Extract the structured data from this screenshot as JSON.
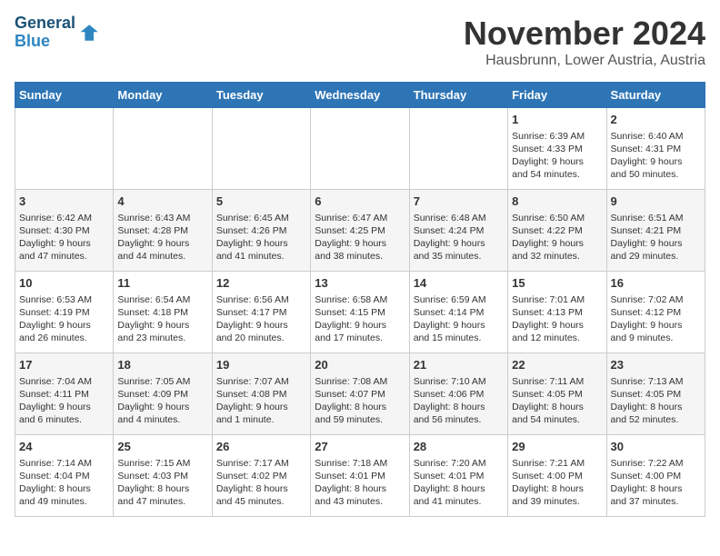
{
  "header": {
    "logo_line1": "General",
    "logo_line2": "Blue",
    "month": "November 2024",
    "location": "Hausbrunn, Lower Austria, Austria"
  },
  "weekdays": [
    "Sunday",
    "Monday",
    "Tuesday",
    "Wednesday",
    "Thursday",
    "Friday",
    "Saturday"
  ],
  "weeks": [
    [
      {
        "day": "",
        "info": ""
      },
      {
        "day": "",
        "info": ""
      },
      {
        "day": "",
        "info": ""
      },
      {
        "day": "",
        "info": ""
      },
      {
        "day": "",
        "info": ""
      },
      {
        "day": "1",
        "info": "Sunrise: 6:39 AM\nSunset: 4:33 PM\nDaylight: 9 hours\nand 54 minutes."
      },
      {
        "day": "2",
        "info": "Sunrise: 6:40 AM\nSunset: 4:31 PM\nDaylight: 9 hours\nand 50 minutes."
      }
    ],
    [
      {
        "day": "3",
        "info": "Sunrise: 6:42 AM\nSunset: 4:30 PM\nDaylight: 9 hours\nand 47 minutes."
      },
      {
        "day": "4",
        "info": "Sunrise: 6:43 AM\nSunset: 4:28 PM\nDaylight: 9 hours\nand 44 minutes."
      },
      {
        "day": "5",
        "info": "Sunrise: 6:45 AM\nSunset: 4:26 PM\nDaylight: 9 hours\nand 41 minutes."
      },
      {
        "day": "6",
        "info": "Sunrise: 6:47 AM\nSunset: 4:25 PM\nDaylight: 9 hours\nand 38 minutes."
      },
      {
        "day": "7",
        "info": "Sunrise: 6:48 AM\nSunset: 4:24 PM\nDaylight: 9 hours\nand 35 minutes."
      },
      {
        "day": "8",
        "info": "Sunrise: 6:50 AM\nSunset: 4:22 PM\nDaylight: 9 hours\nand 32 minutes."
      },
      {
        "day": "9",
        "info": "Sunrise: 6:51 AM\nSunset: 4:21 PM\nDaylight: 9 hours\nand 29 minutes."
      }
    ],
    [
      {
        "day": "10",
        "info": "Sunrise: 6:53 AM\nSunset: 4:19 PM\nDaylight: 9 hours\nand 26 minutes."
      },
      {
        "day": "11",
        "info": "Sunrise: 6:54 AM\nSunset: 4:18 PM\nDaylight: 9 hours\nand 23 minutes."
      },
      {
        "day": "12",
        "info": "Sunrise: 6:56 AM\nSunset: 4:17 PM\nDaylight: 9 hours\nand 20 minutes."
      },
      {
        "day": "13",
        "info": "Sunrise: 6:58 AM\nSunset: 4:15 PM\nDaylight: 9 hours\nand 17 minutes."
      },
      {
        "day": "14",
        "info": "Sunrise: 6:59 AM\nSunset: 4:14 PM\nDaylight: 9 hours\nand 15 minutes."
      },
      {
        "day": "15",
        "info": "Sunrise: 7:01 AM\nSunset: 4:13 PM\nDaylight: 9 hours\nand 12 minutes."
      },
      {
        "day": "16",
        "info": "Sunrise: 7:02 AM\nSunset: 4:12 PM\nDaylight: 9 hours\nand 9 minutes."
      }
    ],
    [
      {
        "day": "17",
        "info": "Sunrise: 7:04 AM\nSunset: 4:11 PM\nDaylight: 9 hours\nand 6 minutes."
      },
      {
        "day": "18",
        "info": "Sunrise: 7:05 AM\nSunset: 4:09 PM\nDaylight: 9 hours\nand 4 minutes."
      },
      {
        "day": "19",
        "info": "Sunrise: 7:07 AM\nSunset: 4:08 PM\nDaylight: 9 hours\nand 1 minute."
      },
      {
        "day": "20",
        "info": "Sunrise: 7:08 AM\nSunset: 4:07 PM\nDaylight: 8 hours\nand 59 minutes."
      },
      {
        "day": "21",
        "info": "Sunrise: 7:10 AM\nSunset: 4:06 PM\nDaylight: 8 hours\nand 56 minutes."
      },
      {
        "day": "22",
        "info": "Sunrise: 7:11 AM\nSunset: 4:05 PM\nDaylight: 8 hours\nand 54 minutes."
      },
      {
        "day": "23",
        "info": "Sunrise: 7:13 AM\nSunset: 4:05 PM\nDaylight: 8 hours\nand 52 minutes."
      }
    ],
    [
      {
        "day": "24",
        "info": "Sunrise: 7:14 AM\nSunset: 4:04 PM\nDaylight: 8 hours\nand 49 minutes."
      },
      {
        "day": "25",
        "info": "Sunrise: 7:15 AM\nSunset: 4:03 PM\nDaylight: 8 hours\nand 47 minutes."
      },
      {
        "day": "26",
        "info": "Sunrise: 7:17 AM\nSunset: 4:02 PM\nDaylight: 8 hours\nand 45 minutes."
      },
      {
        "day": "27",
        "info": "Sunrise: 7:18 AM\nSunset: 4:01 PM\nDaylight: 8 hours\nand 43 minutes."
      },
      {
        "day": "28",
        "info": "Sunrise: 7:20 AM\nSunset: 4:01 PM\nDaylight: 8 hours\nand 41 minutes."
      },
      {
        "day": "29",
        "info": "Sunrise: 7:21 AM\nSunset: 4:00 PM\nDaylight: 8 hours\nand 39 minutes."
      },
      {
        "day": "30",
        "info": "Sunrise: 7:22 AM\nSunset: 4:00 PM\nDaylight: 8 hours\nand 37 minutes."
      }
    ]
  ]
}
